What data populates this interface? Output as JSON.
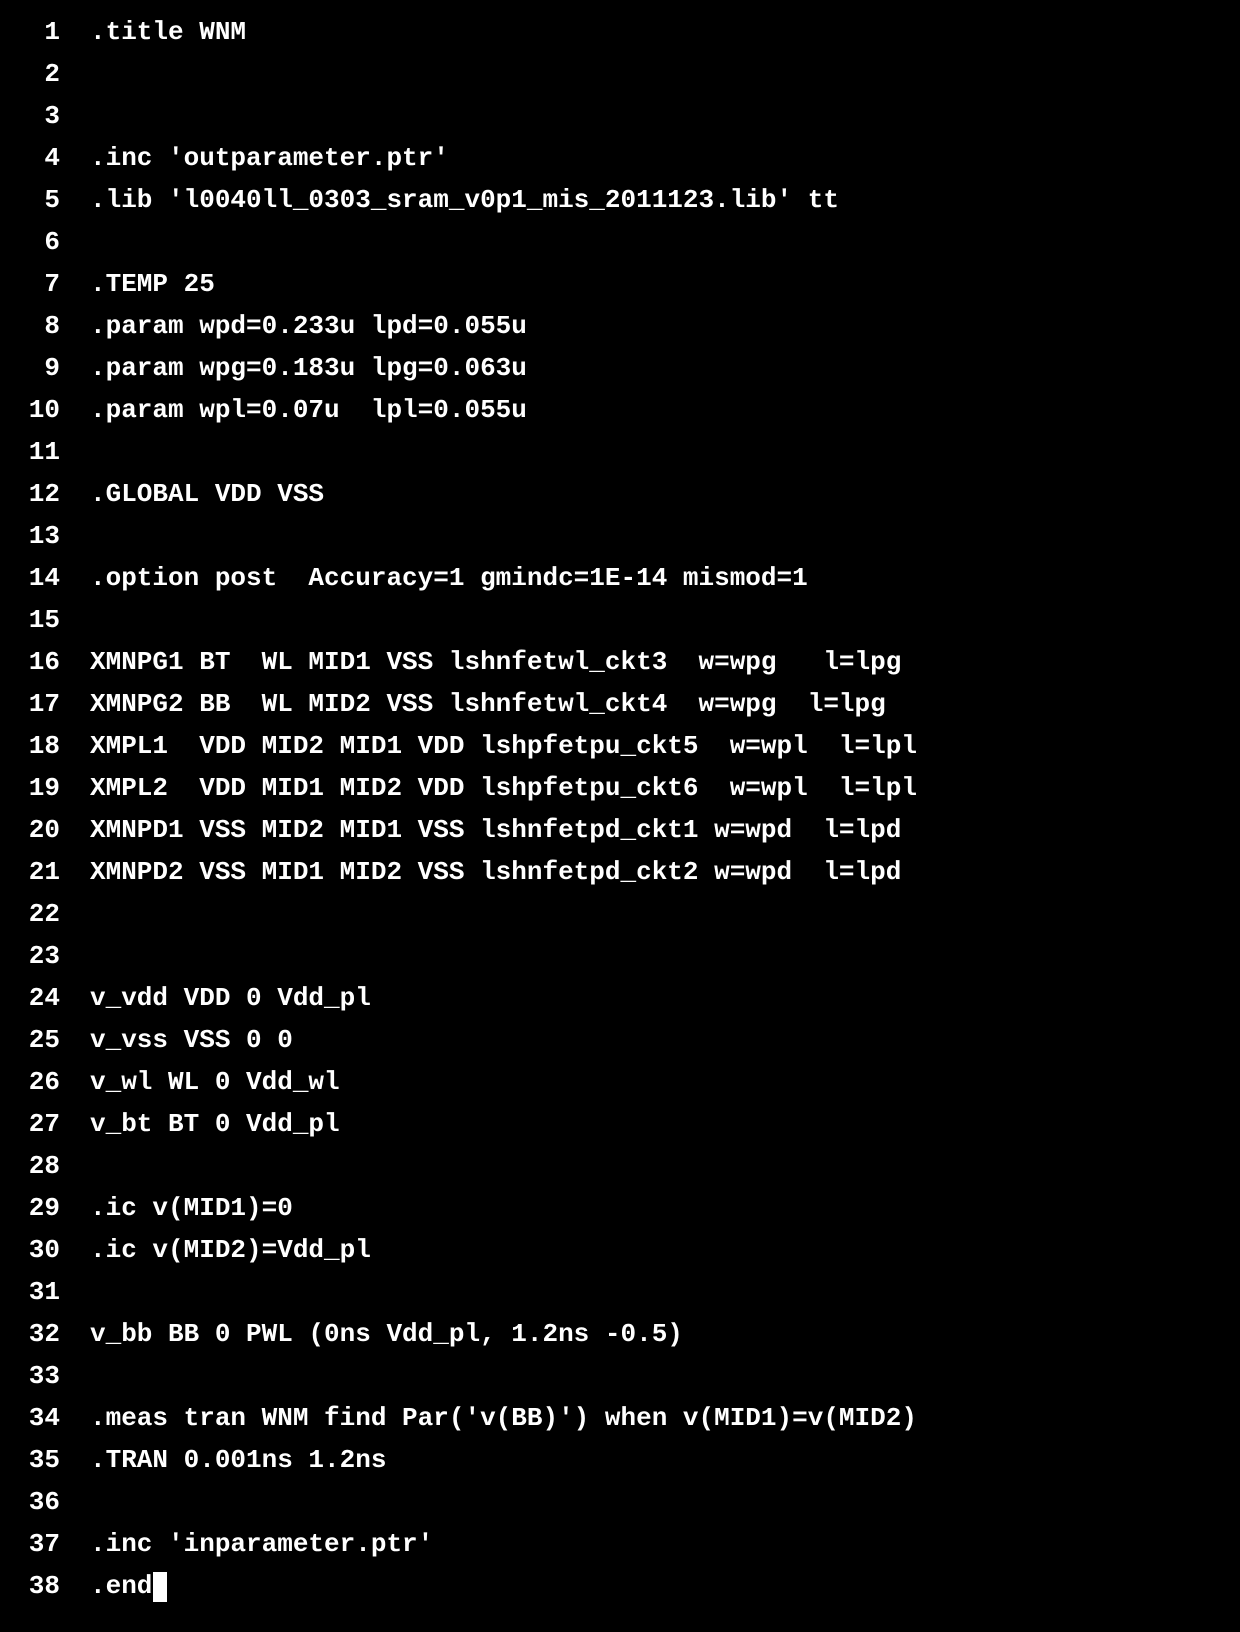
{
  "editor": {
    "lines": [
      {
        "num": "1",
        "text": ".title WNM"
      },
      {
        "num": "2",
        "text": ""
      },
      {
        "num": "3",
        "text": ""
      },
      {
        "num": "4",
        "text": ".inc 'outparameter.ptr'"
      },
      {
        "num": "5",
        "text": ".lib 'l0040ll_0303_sram_v0p1_mis_2011123.lib' tt"
      },
      {
        "num": "6",
        "text": ""
      },
      {
        "num": "7",
        "text": ".TEMP 25"
      },
      {
        "num": "8",
        "text": ".param wpd=0.233u lpd=0.055u"
      },
      {
        "num": "9",
        "text": ".param wpg=0.183u lpg=0.063u"
      },
      {
        "num": "10",
        "text": ".param wpl=0.07u  lpl=0.055u"
      },
      {
        "num": "11",
        "text": ""
      },
      {
        "num": "12",
        "text": ".GLOBAL VDD VSS"
      },
      {
        "num": "13",
        "text": ""
      },
      {
        "num": "14",
        "text": ".option post  Accuracy=1 gmindc=1E-14 mismod=1"
      },
      {
        "num": "15",
        "text": ""
      },
      {
        "num": "16",
        "text": "XMNPG1 BT  WL MID1 VSS lshnfetwl_ckt3  w=wpg   l=lpg"
      },
      {
        "num": "17",
        "text": "XMNPG2 BB  WL MID2 VSS lshnfetwl_ckt4  w=wpg  l=lpg"
      },
      {
        "num": "18",
        "text": "XMPL1  VDD MID2 MID1 VDD lshpfetpu_ckt5  w=wpl  l=lpl"
      },
      {
        "num": "19",
        "text": "XMPL2  VDD MID1 MID2 VDD lshpfetpu_ckt6  w=wpl  l=lpl"
      },
      {
        "num": "20",
        "text": "XMNPD1 VSS MID2 MID1 VSS lshnfetpd_ckt1 w=wpd  l=lpd"
      },
      {
        "num": "21",
        "text": "XMNPD2 VSS MID1 MID2 VSS lshnfetpd_ckt2 w=wpd  l=lpd"
      },
      {
        "num": "22",
        "text": ""
      },
      {
        "num": "23",
        "text": ""
      },
      {
        "num": "24",
        "text": "v_vdd VDD 0 Vdd_pl"
      },
      {
        "num": "25",
        "text": "v_vss VSS 0 0"
      },
      {
        "num": "26",
        "text": "v_wl WL 0 Vdd_wl"
      },
      {
        "num": "27",
        "text": "v_bt BT 0 Vdd_pl"
      },
      {
        "num": "28",
        "text": ""
      },
      {
        "num": "29",
        "text": ".ic v(MID1)=0"
      },
      {
        "num": "30",
        "text": ".ic v(MID2)=Vdd_pl"
      },
      {
        "num": "31",
        "text": ""
      },
      {
        "num": "32",
        "text": "v_bb BB 0 PWL (0ns Vdd_pl, 1.2ns -0.5)"
      },
      {
        "num": "33",
        "text": ""
      },
      {
        "num": "34",
        "text": ".meas tran WNM find Par('v(BB)') when v(MID1)=v(MID2)"
      },
      {
        "num": "35",
        "text": ".TRAN 0.001ns 1.2ns"
      },
      {
        "num": "36",
        "text": ""
      },
      {
        "num": "37",
        "text": ".inc 'inparameter.ptr'"
      },
      {
        "num": "38",
        "text": ".end"
      }
    ],
    "cursor_line": 38
  }
}
